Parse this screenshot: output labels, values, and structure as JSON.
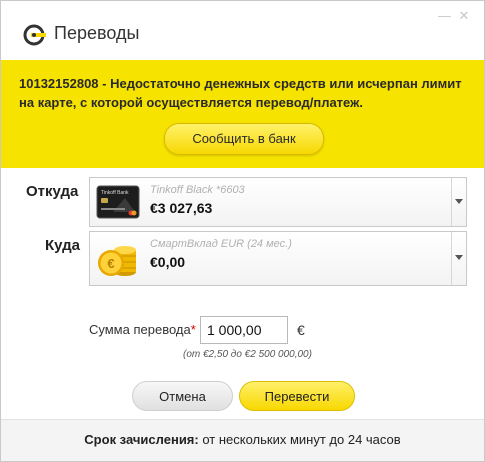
{
  "window": {
    "title": "Переводы",
    "minimize_glyph": "—",
    "close_glyph": "✕"
  },
  "alert": {
    "message": "10132152808 - Недостаточно денежных средств или исчерпан лимит на карте, с которой осуществляется перевод/платеж.",
    "report_button": "Сообщить в банк"
  },
  "from": {
    "label": "Откуда",
    "account_name": "Tinkoff Black *6603",
    "balance": "€3 027,63",
    "icon": "card-icon"
  },
  "to": {
    "label": "Куда",
    "account_name": "СмартВклад EUR (24 мес.)",
    "balance": "€0,00",
    "icon": "coins-icon"
  },
  "amount": {
    "label": "Сумма перевода",
    "required_mark": "*",
    "value": "1 000,00",
    "currency": "€",
    "limits": "(от €2,50 до €2 500 000,00)"
  },
  "actions": {
    "cancel": "Отмена",
    "submit": "Перевести"
  },
  "footer": {
    "term_label": "Срок зачисления:",
    "term_value": " от нескольких минут до 24 часов"
  },
  "colors": {
    "accent_yellow": "#f7e300",
    "button_yellow": "#f8d800",
    "required_red": "#d10000"
  }
}
